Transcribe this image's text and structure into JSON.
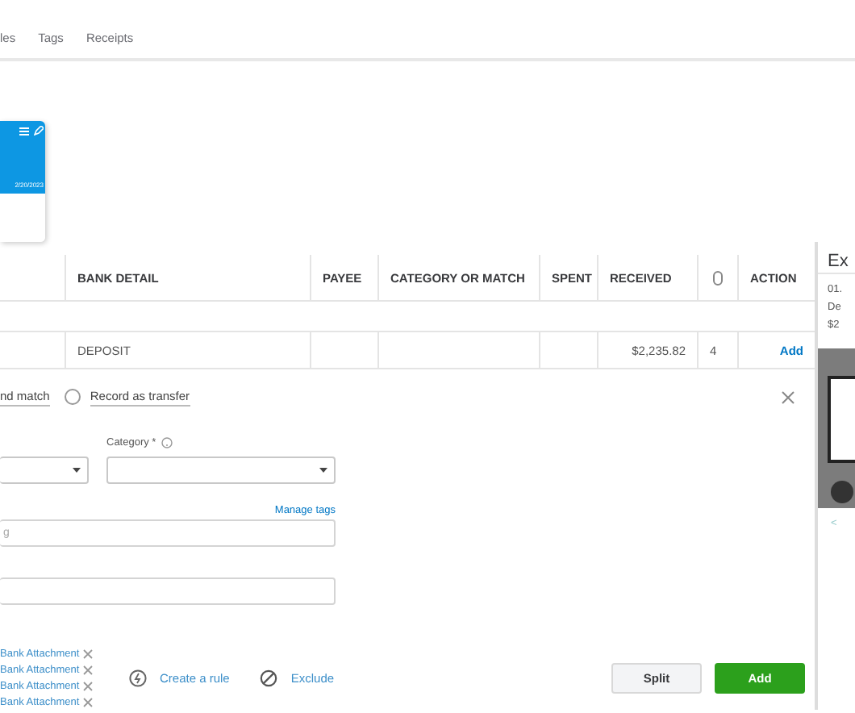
{
  "tabs": [
    {
      "label": "les",
      "selected": false
    },
    {
      "label": "Tags",
      "selected": false
    },
    {
      "label": "Receipts",
      "selected": false
    }
  ],
  "account_card": {
    "date": "2/20/2023"
  },
  "table": {
    "columns": [
      "BANK DETAIL",
      "PAYEE",
      "CATEGORY OR MATCH",
      "SPENT",
      "RECEIVED",
      "ACTION"
    ],
    "rows": [
      {
        "bank_detail": "DEPOSIT",
        "received": "$2,235.82",
        "attachments": "4",
        "action": "Add"
      }
    ]
  },
  "match_link": "nd match",
  "transfer_option": {
    "label": "Record as transfer",
    "selected": false
  },
  "form": {
    "category_label": "Category *",
    "manage_tags": "Manage tags",
    "tags_placeholder": "g"
  },
  "attachments": [
    "Bank Attachment",
    "Bank Attachment",
    "Bank Attachment",
    "Bank Attachment"
  ],
  "actions": [
    "Create a rule",
    "Exclude"
  ],
  "buttons": [
    "Split",
    "Add"
  ],
  "right_panel": {
    "title": "Ex",
    "lines": [
      "01.",
      "De",
      "$2"
    ],
    "link": "<"
  }
}
